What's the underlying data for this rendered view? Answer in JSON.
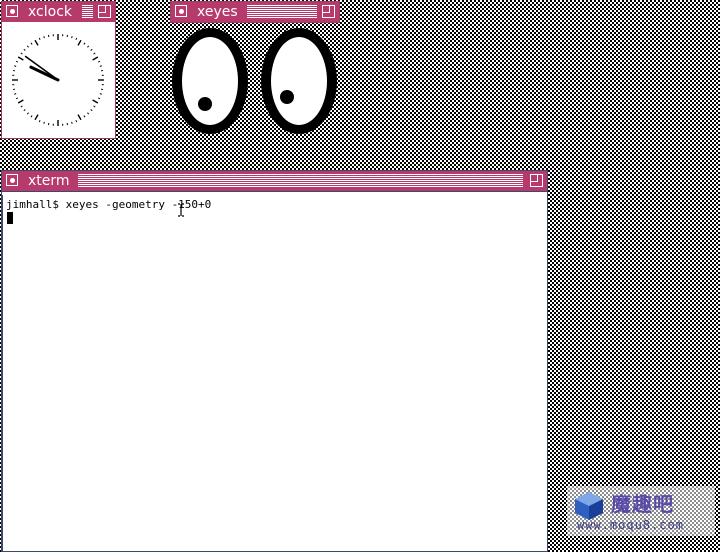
{
  "xclock": {
    "title": "xclock",
    "time": {
      "hour": 9,
      "minute": 51
    }
  },
  "xeyes": {
    "title": "xeyes"
  },
  "xterm": {
    "title": "xterm",
    "lines": [
      "jimhall$ xeyes -geometry -150+0"
    ]
  },
  "watermark": {
    "text": "魔趣吧",
    "url": "www.moqu8.com"
  },
  "colors": {
    "titlebar": "#b63a6b",
    "desktop_pattern": "checker-stipple"
  },
  "icons": {
    "window_menu": "window-menu-icon",
    "resize": "resize-icon"
  }
}
